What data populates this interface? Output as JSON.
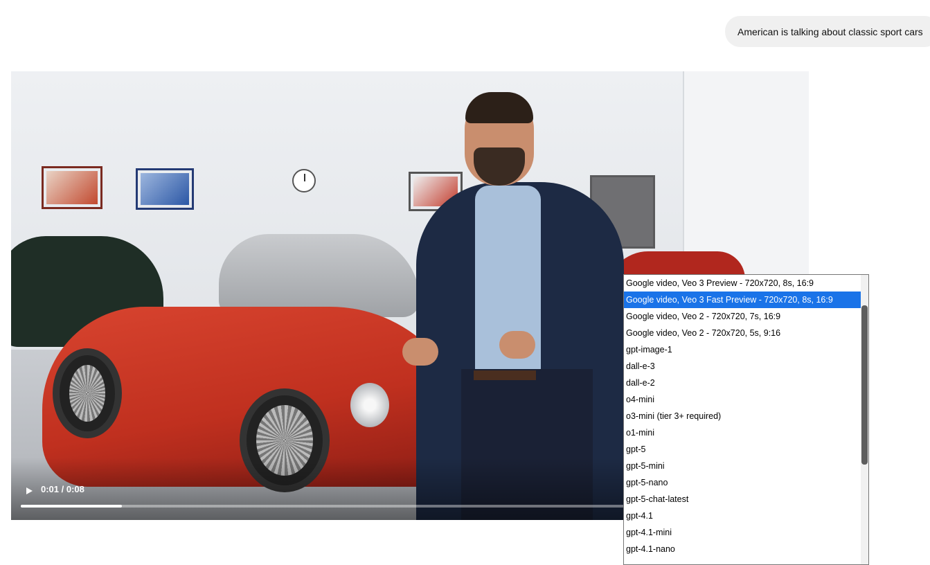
{
  "chat": {
    "user_message": "American is talking about classic sport cars"
  },
  "video": {
    "play_icon": "play-icon",
    "time": "0:01 / 0:08",
    "progress": 0.13
  },
  "model_dropdown": {
    "selected_index": 1,
    "options": [
      "Google video, Veo 3 Preview - 720x720, 8s, 16:9",
      "Google video, Veo 3 Fast Preview - 720x720, 8s, 16:9",
      "Google video, Veo 2 - 720x720, 7s, 16:9",
      "Google video, Veo 2 - 720x720, 5s, 9:16",
      "gpt-image-1",
      "dall-e-3",
      "dall-e-2",
      "o4-mini",
      "o3-mini (tier 3+ required)",
      "o1-mini",
      "gpt-5",
      "gpt-5-mini",
      "gpt-5-nano",
      "gpt-5-chat-latest",
      "gpt-4.1",
      "gpt-4.1-mini",
      "gpt-4.1-nano"
    ]
  }
}
